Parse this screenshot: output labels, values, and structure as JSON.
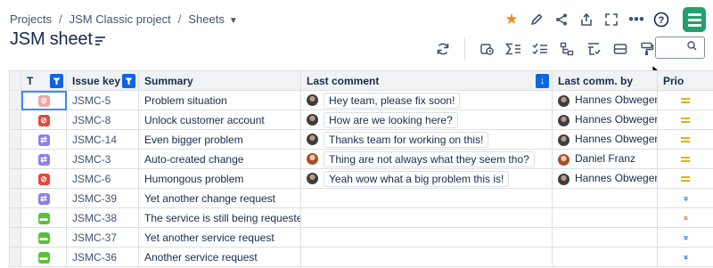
{
  "breadcrumb": {
    "projects": "Projects",
    "project": "JSM Classic project",
    "sheets": "Sheets"
  },
  "page": {
    "title": "JSM sheet"
  },
  "top_icons": [
    "star-icon",
    "pencil-icon",
    "share-icon",
    "export-icon",
    "fullscreen-icon",
    "more-icon",
    "help-icon",
    "app-logo"
  ],
  "toolbar_icons": [
    "refresh-icon",
    "timer-icon",
    "sum-icon",
    "checklist-icon",
    "hierarchy-icon",
    "filter-list-icon",
    "row-height-icon",
    "paint-format-icon",
    "search-icon"
  ],
  "search": {
    "value": ""
  },
  "colors": {
    "accent": "#0c66e4",
    "star": "#f18d13",
    "app_logo": "#22a06b",
    "priority_medium": "#e2b203",
    "priority_low": "#0c66e4",
    "priority_high": "#e56910"
  },
  "table": {
    "columns": {
      "type": "T",
      "issue_key": "Issue key",
      "summary": "Summary",
      "last_comment": "Last comment",
      "last_comm_by": "Last comm. by",
      "priority": "Prio"
    },
    "rows": [
      {
        "type": "incident",
        "key": "JSMC-5",
        "summary": "Problem situation",
        "comment": "Hey team, please fix soon!",
        "by": "Hannes Obweger",
        "priority": "medium"
      },
      {
        "type": "incident",
        "key": "JSMC-8",
        "summary": "Unlock customer account",
        "comment": "How are we looking here?",
        "by": "Hannes Obweger",
        "priority": "medium"
      },
      {
        "type": "change",
        "key": "JSMC-14",
        "summary": "Even bigger problem",
        "comment": "Thanks team for working on this!",
        "by": "Hannes Obweger",
        "priority": "medium"
      },
      {
        "type": "change",
        "key": "JSMC-3",
        "summary": "Auto-created change",
        "comment": "Thing are not always what they seem tho?",
        "by": "Daniel Franz",
        "priority": "medium"
      },
      {
        "type": "incident",
        "key": "JSMC-6",
        "summary": "Humongous problem",
        "comment": "Yeah wow what a big problem this is!",
        "by": "Hannes Obweger",
        "priority": "medium"
      },
      {
        "type": "change",
        "key": "JSMC-39",
        "summary": "Yet another change request",
        "comment": "",
        "by": "",
        "priority": "low"
      },
      {
        "type": "service",
        "key": "JSMC-38",
        "summary": "The service is still being requested",
        "comment": "",
        "by": "",
        "priority": "high"
      },
      {
        "type": "service",
        "key": "JSMC-37",
        "summary": "Yet another service request",
        "comment": "",
        "by": "",
        "priority": "low"
      },
      {
        "type": "service",
        "key": "JSMC-36",
        "summary": "Another service request",
        "comment": "",
        "by": "",
        "priority": "low"
      }
    ]
  }
}
